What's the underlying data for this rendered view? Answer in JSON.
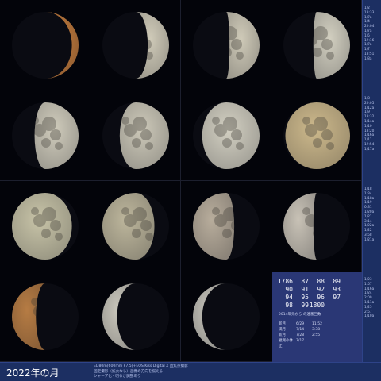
{
  "title": "2022年の月",
  "notes": [
    "ED80m(600mm F7.5)+EOS Kiss Digital X 直焦点撮影",
    "固定撮影（拡大なし）画像の方向を揃える",
    "シャープ化・明るさ調整あり"
  ],
  "side_dates": [
    [
      "1/2",
      "18:33",
      "1/7a",
      "1/4",
      "20:04",
      "1/7a",
      "1/5",
      "19:16",
      "1/7a",
      "1/7",
      "18:51",
      "1/8a"
    ],
    [
      "1/8",
      "20:05",
      "1/12a",
      "1/9",
      "18:32",
      "1/14a",
      "1/10",
      "18:20",
      "1/16a",
      "1/11",
      "19:54",
      "1/17a"
    ],
    [
      "1/18",
      "1:34",
      "1/18a",
      "1/19",
      "0:31",
      "1/20a",
      "1/21",
      "3:14",
      "1/22a",
      "1/22",
      "3:58",
      "1/21a"
    ],
    [
      "1/23",
      "1:57",
      "1/16a",
      "1/24",
      "2:09",
      "1/11a",
      "1/25",
      "2:57",
      "1/10a"
    ]
  ],
  "counts": [
    [
      "1786",
      "87",
      "88",
      "89"
    ],
    [
      "90",
      "91",
      "92",
      "93"
    ],
    [
      "94",
      "95",
      "96",
      "97"
    ],
    [
      "98",
      "99",
      "1800",
      ""
    ]
  ],
  "count_caption": "2014年元から の連番回数",
  "stats": [
    {
      "label": "新月",
      "date": "6/29",
      "time": "11:52"
    },
    {
      "label": "満月",
      "date": "7/14",
      "time": "3:38"
    },
    {
      "label": "新月",
      "date": "7/28",
      "time": "2:55"
    },
    {
      "label": "観測小休止",
      "date": "7/17",
      "time": ""
    }
  ],
  "moons": [
    {
      "phase": "waxing",
      "illum": 0.1,
      "color": "#c07a3c"
    },
    {
      "phase": "waxing",
      "illum": 0.32,
      "color": "#cfcab8"
    },
    {
      "phase": "waxing",
      "illum": 0.45,
      "color": "#cfcab8"
    },
    {
      "phase": "waxing",
      "illum": 0.55,
      "color": "#d2cfc0"
    },
    {
      "phase": "waxing",
      "illum": 0.66,
      "color": "#d0ccbc"
    },
    {
      "phase": "waxing",
      "illum": 0.74,
      "color": "#cdc9b9"
    },
    {
      "phase": "waxing",
      "illum": 0.86,
      "color": "#d3d0c2"
    },
    {
      "phase": "waxing",
      "illum": 0.97,
      "color": "#cdb98c"
    },
    {
      "phase": "waning",
      "illum": 0.9,
      "color": "#c8c4a8"
    },
    {
      "phase": "waning",
      "illum": 0.78,
      "color": "#bdb69c"
    },
    {
      "phase": "waning",
      "illum": 0.62,
      "color": "#b8ad9c"
    },
    {
      "phase": "waning",
      "illum": 0.45,
      "color": "#c8c2b6"
    },
    {
      "phase": "waning",
      "illum": 0.36,
      "color": "#b67c44"
    },
    {
      "phase": "waning",
      "illum": 0.22,
      "color": "#c9c6bb"
    },
    {
      "phase": "waning",
      "illum": 0.14,
      "color": "#c3c1b8"
    }
  ]
}
